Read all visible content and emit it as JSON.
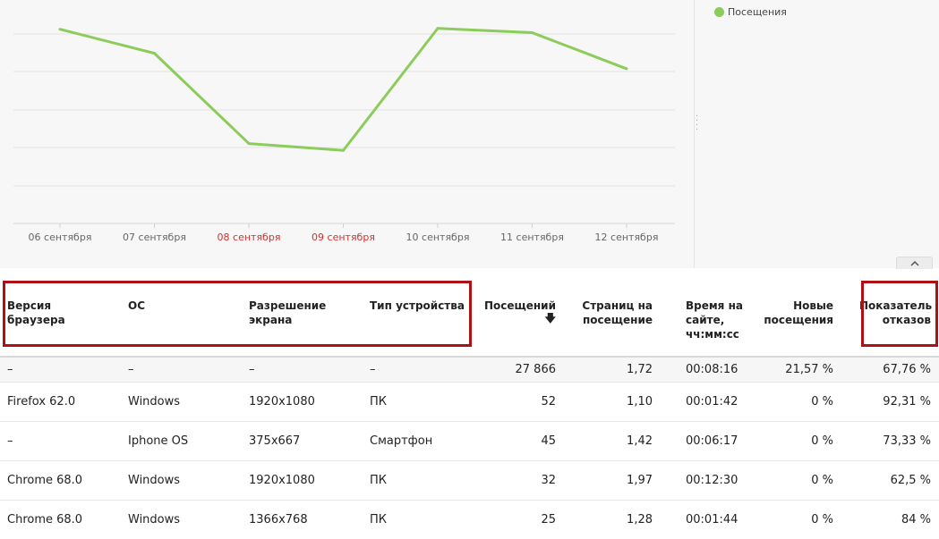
{
  "chart_data": {
    "type": "line",
    "x": [
      "06 сентября",
      "07 сентября",
      "08 сентября",
      "09 сентября",
      "10 сентября",
      "11 сентября",
      "12 сентября"
    ],
    "weekend_flags": [
      false,
      false,
      true,
      true,
      false,
      false,
      false
    ],
    "series": [
      {
        "name": "Посещения",
        "values": [
          5260,
          4980,
          3930,
          3850,
          5270,
          5220,
          4800
        ],
        "color": "#8ccc5b"
      }
    ],
    "ylim": [
      3000,
      5600
    ],
    "grid": true,
    "legend": "right",
    "colors": {
      "weekend_label": "#d0312d",
      "axis_label": "#666666",
      "grid": "#e2e2e2"
    }
  },
  "legend": {
    "label": "Посещения"
  },
  "table": {
    "headers": {
      "browser": "Версия браузера",
      "os": "ОС",
      "resolution": "Разрешение экрана",
      "device": "Тип устройства",
      "visits": "Посещений",
      "pages": "Страниц на посещение",
      "time": "Время на сайте, чч:мм:сс",
      "new_visits": "Новые посещения",
      "bounce": "Показатель отказов"
    },
    "sort_indicator": "🡇",
    "totals": {
      "browser": "–",
      "os": "–",
      "resolution": "–",
      "device": "–",
      "visits": "27 866",
      "pages": "1,72",
      "time": "00:08:16",
      "new_visits": "21,57 %",
      "bounce": "67,76 %"
    },
    "rows": [
      {
        "browser": "Firefox 62.0",
        "os": "Windows",
        "resolution": "1920x1080",
        "device": "ПК",
        "visits": "52",
        "pages": "1,10",
        "time": "00:01:42",
        "new_visits": "0 %",
        "bounce": "92,31 %"
      },
      {
        "browser": "–",
        "os": "Iphone OS",
        "resolution": "375x667",
        "device": "Смартфон",
        "visits": "45",
        "pages": "1,42",
        "time": "00:06:17",
        "new_visits": "0 %",
        "bounce": "73,33 %"
      },
      {
        "browser": "Chrome 68.0",
        "os": "Windows",
        "resolution": "1920x1080",
        "device": "ПК",
        "visits": "32",
        "pages": "1,97",
        "time": "00:12:30",
        "new_visits": "0 %",
        "bounce": "62,5 %"
      },
      {
        "browser": "Chrome 68.0",
        "os": "Windows",
        "resolution": "1366x768",
        "device": "ПК",
        "visits": "25",
        "pages": "1,28",
        "time": "00:01:44",
        "new_visits": "0 %",
        "bounce": "84 %"
      }
    ]
  },
  "colors": {
    "highlight_box": "#b01014",
    "series_line": "#8ccc5b"
  }
}
